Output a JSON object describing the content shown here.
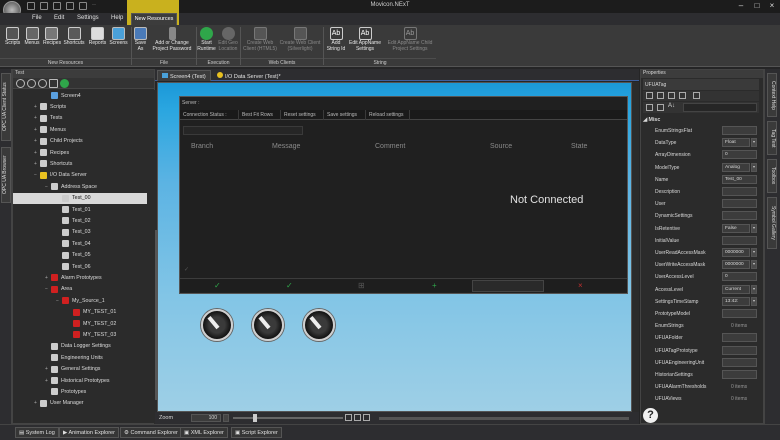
{
  "window": {
    "title": "Movicon.NExT",
    "contextual_tab": "New Resources"
  },
  "menu": {
    "items": [
      "File",
      "Edit",
      "Settings",
      "Help",
      "New Resources"
    ]
  },
  "ribbon": {
    "buttons": [
      {
        "label": "Scripts",
        "icon": "scripts-icon"
      },
      {
        "label": "Menus",
        "icon": "menus-icon"
      },
      {
        "label": "Recipes",
        "icon": "recipes-icon"
      },
      {
        "label": "Shortcuts",
        "icon": "shortcuts-icon"
      },
      {
        "label": "Reports",
        "icon": "reports-icon"
      },
      {
        "label": "Screens",
        "icon": "screens-icon"
      },
      {
        "label": "Save As",
        "icon": "save-icon"
      },
      {
        "label": "Add or Change Project Password",
        "icon": "key-icon"
      },
      {
        "label": "Start Runtime",
        "icon": "play-icon"
      },
      {
        "label": "Edit Geo Location",
        "icon": "globe-icon"
      },
      {
        "label": "Create Web Client (HTML5)",
        "icon": "html5-icon"
      },
      {
        "label": "Create Web Client (Silverlight)",
        "icon": "silverlight-icon"
      },
      {
        "label": "Add String Id",
        "icon": "string-add-icon"
      },
      {
        "label": "Edit AppName Settings",
        "icon": "string-edit-icon"
      },
      {
        "label": "Edit AppName Child Project Settings",
        "icon": "string-child-icon"
      }
    ],
    "groups": [
      "New Resources",
      "File",
      "Execution",
      "Web Clients",
      "String"
    ]
  },
  "left_strip": {
    "tabs": [
      "OPC UA Client Status",
      "OPC UA Browser"
    ]
  },
  "explorer": {
    "title": "Test",
    "tree": [
      {
        "label": "Screen4",
        "level": 2,
        "toggle": "",
        "icon": "#5aa0e0"
      },
      {
        "label": "Scripts",
        "level": 1,
        "toggle": "+",
        "icon": "#cccccc"
      },
      {
        "label": "Tests",
        "level": 1,
        "toggle": "+",
        "icon": "#cccccc"
      },
      {
        "label": "Menus",
        "level": 1,
        "toggle": "+",
        "icon": "#cccccc"
      },
      {
        "label": "Child Projects",
        "level": 1,
        "toggle": "+",
        "icon": "#cccccc"
      },
      {
        "label": "Recipes",
        "level": 1,
        "toggle": "+",
        "icon": "#cccccc"
      },
      {
        "label": "Shortcuts",
        "level": 1,
        "toggle": "+",
        "icon": "#cccccc"
      },
      {
        "label": "I/O Data Server",
        "level": 1,
        "toggle": "−",
        "icon": "#e8c020"
      },
      {
        "label": "Address Space",
        "level": 2,
        "toggle": "−",
        "icon": "#cccccc"
      },
      {
        "label": "Test_00",
        "level": 3,
        "toggle": "",
        "icon": "#cccccc",
        "selected": true
      },
      {
        "label": "Test_01",
        "level": 3,
        "toggle": "",
        "icon": "#cccccc"
      },
      {
        "label": "Test_02",
        "level": 3,
        "toggle": "",
        "icon": "#cccccc"
      },
      {
        "label": "Test_03",
        "level": 3,
        "toggle": "",
        "icon": "#cccccc"
      },
      {
        "label": "Test_04",
        "level": 3,
        "toggle": "",
        "icon": "#cccccc"
      },
      {
        "label": "Test_05",
        "level": 3,
        "toggle": "",
        "icon": "#cccccc"
      },
      {
        "label": "Test_06",
        "level": 3,
        "toggle": "",
        "icon": "#cccccc"
      },
      {
        "label": "Alarm Prototypes",
        "level": 2,
        "toggle": "+",
        "icon": "#d02020"
      },
      {
        "label": "Area",
        "level": 2,
        "toggle": "−",
        "icon": "#d02020"
      },
      {
        "label": "My_Source_1",
        "level": 3,
        "toggle": "−",
        "icon": "#d02020"
      },
      {
        "label": "MY_TEST_01",
        "level": 4,
        "toggle": "",
        "icon": "#d02020"
      },
      {
        "label": "MY_TEST_02",
        "level": 4,
        "toggle": "",
        "icon": "#d02020"
      },
      {
        "label": "MY_TEST_03",
        "level": 4,
        "toggle": "",
        "icon": "#d02020"
      },
      {
        "label": "Data Logger Settings",
        "level": 2,
        "toggle": "",
        "icon": "#cccccc"
      },
      {
        "label": "Engineering Units",
        "level": 2,
        "toggle": "",
        "icon": "#cccccc"
      },
      {
        "label": "General Settings",
        "level": 2,
        "toggle": "+",
        "icon": "#cccccc"
      },
      {
        "label": "Historical Prototypes",
        "level": 2,
        "toggle": "+",
        "icon": "#cccccc"
      },
      {
        "label": "Prototypes",
        "level": 2,
        "toggle": "",
        "icon": "#cccccc"
      },
      {
        "label": "User Manager",
        "level": 1,
        "toggle": "+",
        "icon": "#cccccc"
      }
    ]
  },
  "doc_tabs": [
    {
      "label": "Screen4 (Test)",
      "active": true
    },
    {
      "label": "I/O Data Server (Test)*",
      "active": false
    }
  ],
  "viewer": {
    "server_label": "Server :",
    "tabs": [
      "Connection Status :",
      "Best Fit Rows",
      "Reset settings",
      "Save settings",
      "Reload settings"
    ],
    "columns": [
      "Branch",
      "Message",
      "Comment",
      "Source",
      "State"
    ],
    "status": "Not Connected",
    "footer_icons": [
      "✓",
      "✓",
      "⊞",
      "+",
      "×"
    ]
  },
  "zoom": {
    "label": "Zoom",
    "value": "100"
  },
  "properties": {
    "title": "Properties",
    "object_name": "UFUATag",
    "category": "Misc",
    "rows": [
      {
        "name": "EnumStringsFlat",
        "value": "",
        "dropdown": false
      },
      {
        "name": "DataType",
        "value": "Float",
        "dropdown": true
      },
      {
        "name": "ArrayDimension",
        "value": "0",
        "dropdown": false
      },
      {
        "name": "ModelType",
        "value": "Analog",
        "dropdown": true
      },
      {
        "name": "Name",
        "value": "Test_00",
        "dropdown": false
      },
      {
        "name": "Description",
        "value": "",
        "dropdown": false
      },
      {
        "name": "User",
        "value": "",
        "dropdown": false
      },
      {
        "name": "DynamicSettings",
        "value": "",
        "dropdown": false
      },
      {
        "name": "IsRetentive",
        "value": "False",
        "dropdown": true
      },
      {
        "name": "InitialValue",
        "value": "",
        "dropdown": false
      },
      {
        "name": "UserReadAccessMask",
        "value": "0000000",
        "dropdown": true
      },
      {
        "name": "UserWriteAccessMask",
        "value": "0000000",
        "dropdown": true
      },
      {
        "name": "UserAccessLevel",
        "value": "0",
        "dropdown": false
      },
      {
        "name": "AccessLevel",
        "value": "Current",
        "dropdown": true
      },
      {
        "name": "SettingsTimeStamp",
        "value": "13:42:",
        "dropdown": true
      },
      {
        "name": "PrototypeModel",
        "value": "",
        "dropdown": false
      },
      {
        "name": "EnumStrings",
        "value": "",
        "items": "0 items"
      },
      {
        "name": "UFUAFolder",
        "value": "",
        "dropdown": false
      },
      {
        "name": "UFUATagPrototype",
        "value": "",
        "dropdown": false
      },
      {
        "name": "UFUAEngineeringUnit",
        "value": "",
        "dropdown": false
      },
      {
        "name": "HistorianSettings",
        "value": "",
        "dropdown": false
      },
      {
        "name": "UFUAAlarmThresholds",
        "value": "",
        "items": "0 items"
      },
      {
        "name": "UFUAViews",
        "value": "",
        "items": "0 items"
      }
    ]
  },
  "right_strip": {
    "tabs": [
      "Context Help",
      "Tag Test",
      "Toolbox",
      "Symbol Gallery"
    ]
  },
  "bottom_tabs": [
    "System Log",
    "Animation Explorer",
    "Command Explorer",
    "XML Explorer",
    "Script Explorer"
  ],
  "colors": {
    "accent": "#c9b11e",
    "canvas_top": "#1b98d8",
    "selection": "#d9d9d9"
  }
}
